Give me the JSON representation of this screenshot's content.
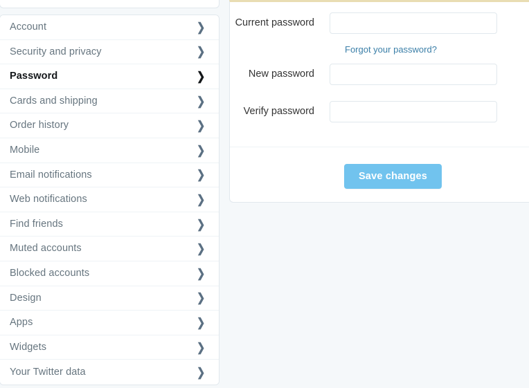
{
  "settings_nav": {
    "items": [
      {
        "label": "Account",
        "name": "account",
        "active": false,
        "chevron": "chevron-right-icon"
      },
      {
        "label": "Security and privacy",
        "name": "security-and-privacy",
        "active": false,
        "chevron": "chevron-right-icon"
      },
      {
        "label": "Password",
        "name": "password",
        "active": true,
        "chevron": "chevron-right-icon"
      },
      {
        "label": "Cards and shipping",
        "name": "cards-and-shipping",
        "active": false,
        "chevron": "chevron-right-icon"
      },
      {
        "label": "Order history",
        "name": "order-history",
        "active": false,
        "chevron": "chevron-right-icon"
      },
      {
        "label": "Mobile",
        "name": "mobile",
        "active": false,
        "chevron": "chevron-right-icon"
      },
      {
        "label": "Email notifications",
        "name": "email-notifications",
        "active": false,
        "chevron": "chevron-right-icon"
      },
      {
        "label": "Web notifications",
        "name": "web-notifications",
        "active": false,
        "chevron": "chevron-right-icon"
      },
      {
        "label": "Find friends",
        "name": "find-friends",
        "active": false,
        "chevron": "chevron-right-icon"
      },
      {
        "label": "Muted accounts",
        "name": "muted-accounts",
        "active": false,
        "chevron": "chevron-right-icon"
      },
      {
        "label": "Blocked accounts",
        "name": "blocked-accounts",
        "active": false,
        "chevron": "chevron-right-icon"
      },
      {
        "label": "Design",
        "name": "design",
        "active": false,
        "chevron": "chevron-right-icon"
      },
      {
        "label": "Apps",
        "name": "apps",
        "active": false,
        "chevron": "chevron-right-icon"
      },
      {
        "label": "Widgets",
        "name": "widgets",
        "active": false,
        "chevron": "chevron-right-icon"
      },
      {
        "label": "Your Twitter data",
        "name": "your-twitter-data",
        "active": false,
        "chevron": "chevron-right-icon"
      }
    ]
  },
  "password_form": {
    "current_password": {
      "label": "Current password",
      "value": "",
      "placeholder": ""
    },
    "forgot_link": "Forgot your password?",
    "new_password": {
      "label": "New password",
      "value": "",
      "placeholder": ""
    },
    "verify_password": {
      "label": "Verify password",
      "value": "",
      "placeholder": ""
    },
    "save_button": "Save changes"
  },
  "colors": {
    "page_background": "#f5f8fa",
    "card_background": "#ffffff",
    "card_border": "#e1e8ed",
    "panel_top_accent": "#e9ddb3",
    "nav_label": "#66757f",
    "nav_label_active": "#14171a",
    "link_blue": "#3b7fa8",
    "button_blue": "#71c3ee",
    "field_label": "#333333"
  },
  "icons": {
    "chevron_right": "❯"
  }
}
